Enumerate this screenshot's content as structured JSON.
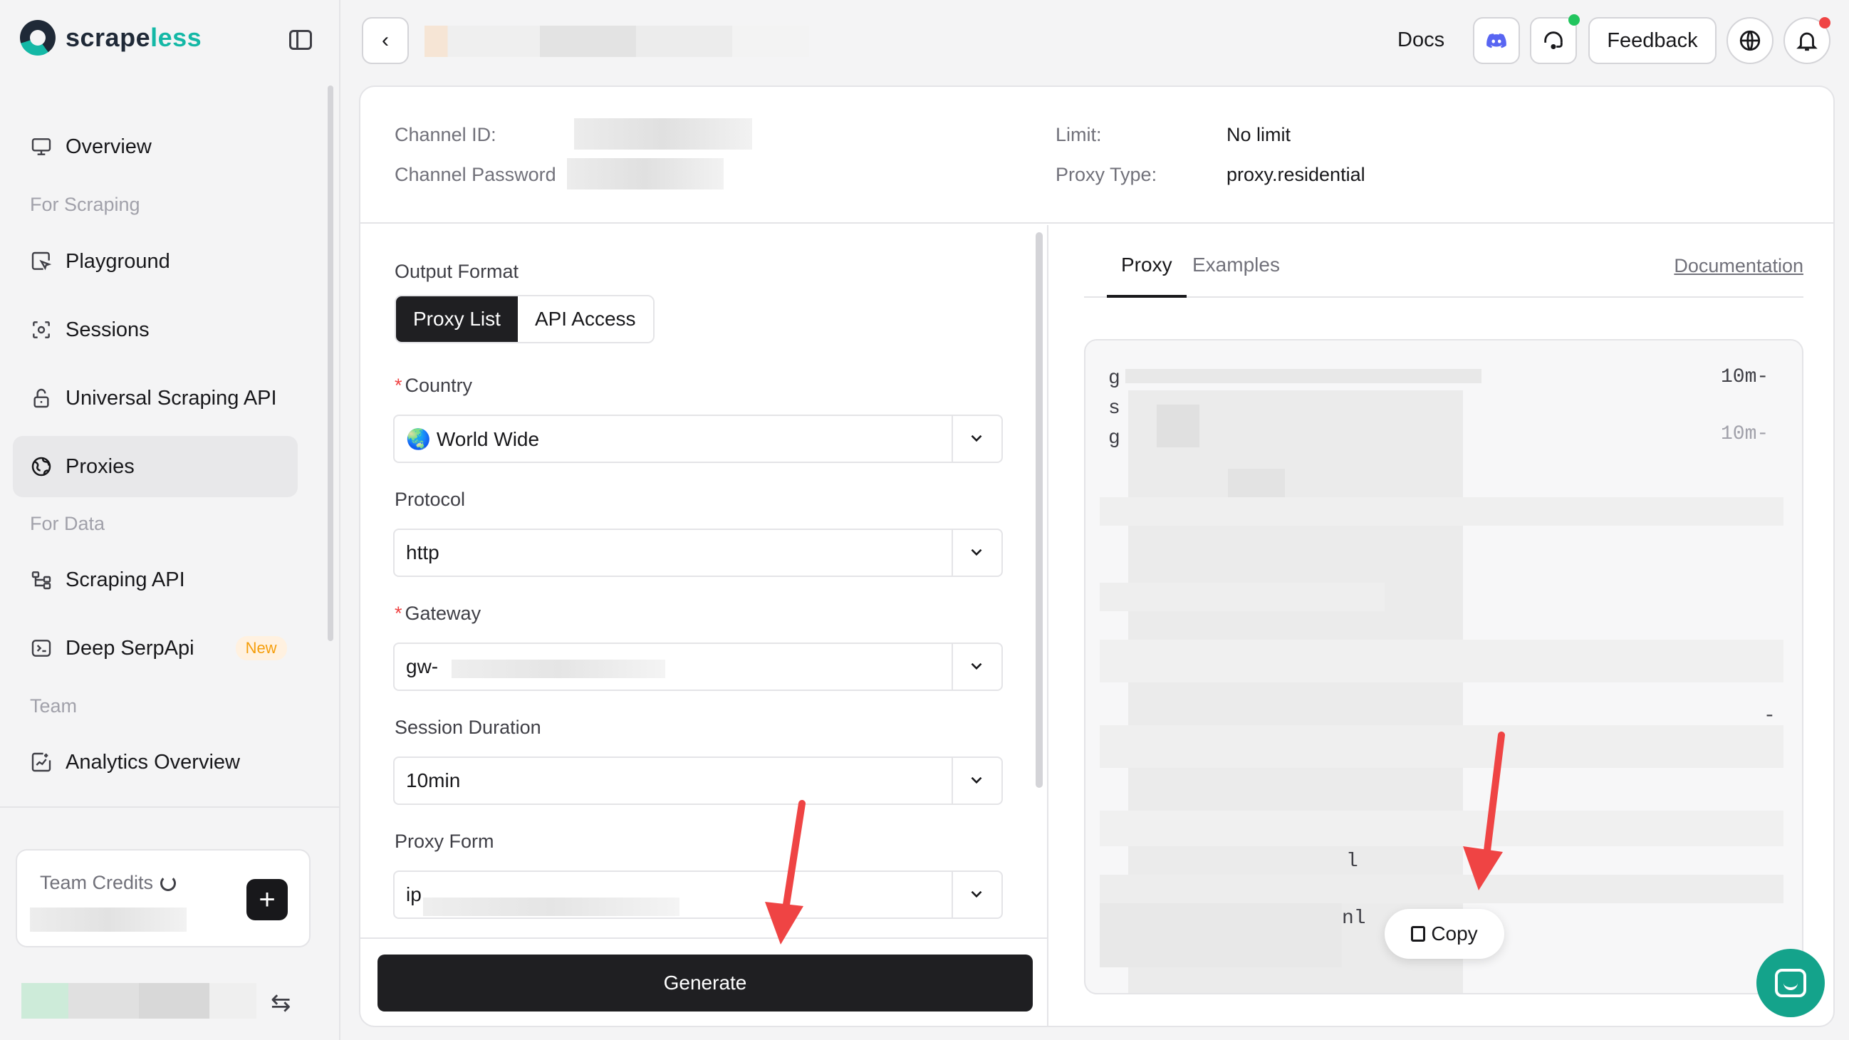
{
  "brand": {
    "name_main": "scrape",
    "name_accent": "less"
  },
  "sidebar": {
    "items": [
      {
        "label": "Overview",
        "icon": "monitor-icon"
      },
      {
        "label": "Playground",
        "icon": "cursor-icon"
      },
      {
        "label": "Sessions",
        "icon": "sessions-icon"
      },
      {
        "label": "Universal Scraping API",
        "icon": "lock-icon"
      },
      {
        "label": "Proxies",
        "icon": "globe-icon"
      },
      {
        "label": "Scraping API",
        "icon": "api-icon"
      },
      {
        "label": "Deep SerpApi",
        "icon": "terminal-icon",
        "badge": "New"
      },
      {
        "label": "Analytics Overview",
        "icon": "analytics-icon"
      }
    ],
    "sections": [
      "For Scraping",
      "For Data",
      "Team"
    ],
    "credits_label": "Team Credits",
    "add_label": "+",
    "switch_label": "⇆"
  },
  "topbar": {
    "docs": "Docs",
    "feedback": "Feedback",
    "back": "‹"
  },
  "info": {
    "channel_id_label": "Channel ID:",
    "channel_password_label": "Channel Password",
    "limit_label": "Limit:",
    "limit_value": "No limit",
    "proxy_type_label": "Proxy Type:",
    "proxy_type_value": "proxy.residential"
  },
  "form": {
    "output_format_label": "Output Format",
    "output_options": [
      "Proxy List",
      "API Access"
    ],
    "country_label": "Country",
    "country_value": "World Wide",
    "country_flag": "🌏",
    "protocol_label": "Protocol",
    "protocol_value": "http",
    "gateway_label": "Gateway",
    "gateway_value": "gw-",
    "session_label": "Session Duration",
    "session_value": "10min",
    "proxy_form_label": "Proxy Form",
    "proxy_form_value": "ip",
    "generate": "Generate"
  },
  "output": {
    "tabs": [
      "Proxy",
      "Examples"
    ],
    "documentation": "Documentation",
    "fragments": [
      "g",
      "s",
      "g",
      "10m-",
      "10m-",
      "-",
      "l",
      "nl"
    ],
    "copy": "Copy"
  },
  "colors": {
    "accent": "#14b8a6",
    "annotation_arrow": "#ef4444",
    "chat": "#14a38b"
  }
}
